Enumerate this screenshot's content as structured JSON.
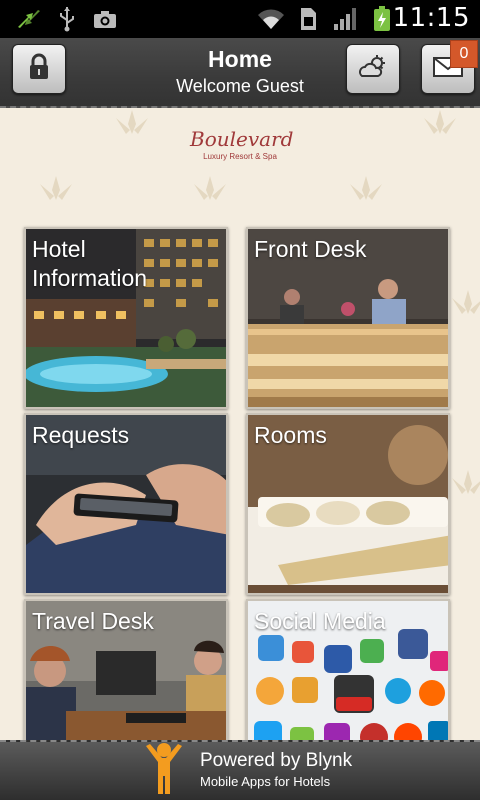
{
  "status_bar": {
    "time": "11:15",
    "icons": [
      "sync-icon",
      "usb-icon",
      "camera-icon",
      "wifi-icon",
      "sim-icon",
      "signal-icon",
      "battery-charging-icon"
    ]
  },
  "header": {
    "title": "Home",
    "subtitle": "Welcome Guest",
    "left_button_icon": "lock-icon",
    "right_buttons": [
      "weather-icon",
      "mail-icon"
    ],
    "mail_badge": "0",
    "badge_color": "#d4582a"
  },
  "logo": {
    "name": "Boulevard",
    "tagline": "Luxury Resort & Spa",
    "color": "#a0393a"
  },
  "tiles": [
    {
      "label": "Hotel\nInformation"
    },
    {
      "label": "Front Desk"
    },
    {
      "label": "Requests"
    },
    {
      "label": "Rooms"
    },
    {
      "label": "Travel Desk"
    },
    {
      "label": "Social Media"
    }
  ],
  "footer": {
    "powered_by": "Powered by Blynk",
    "tagline": "Mobile Apps for Hotels",
    "icon": "blynk-person-icon"
  }
}
